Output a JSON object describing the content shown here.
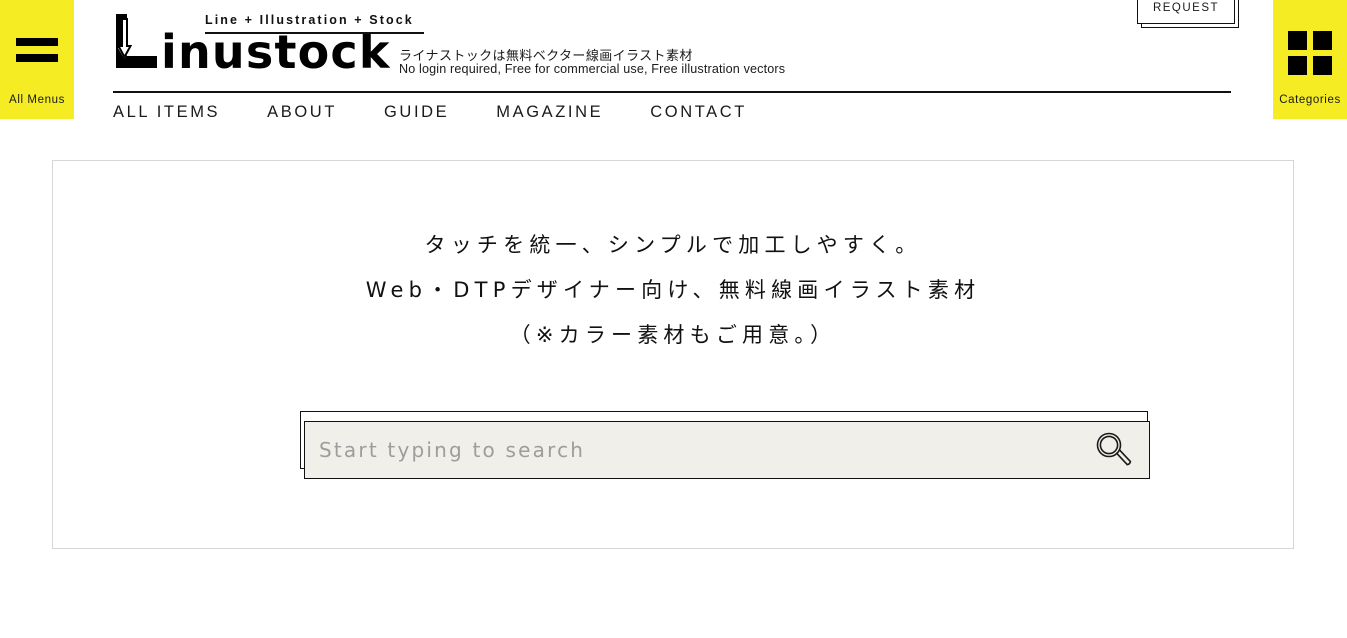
{
  "site": {
    "logo_tagline": "Line + Illustration + Stock",
    "logo_word": "inustock",
    "logo_mark_icon": "l-arrow-logo-icon",
    "tagline_jp": "ライナストックは無料ベクター線画イラスト素材",
    "tagline_en": "No login required, Free for commercial use, Free illustration vectors"
  },
  "colors": {
    "accent_yellow": "#f5ec24",
    "ink": "#111111",
    "search_field_bg": "#f0efe9",
    "content_border": "#d6d6d6",
    "placeholder_text": "#9d9d9d"
  },
  "header": {
    "request_label": "REQUEST",
    "left_tab": {
      "label": "All Menus",
      "icon": "hamburger-icon"
    },
    "right_tab": {
      "label": "Categories",
      "icon": "grid-2x2-icon"
    }
  },
  "nav": {
    "items": [
      {
        "label": "ALL ITEMS"
      },
      {
        "label": "ABOUT"
      },
      {
        "label": "GUIDE"
      },
      {
        "label": "MAGAZINE"
      },
      {
        "label": "CONTACT"
      }
    ]
  },
  "hero": {
    "lines": [
      "タッチを統一、シンプルで加工しやすく。",
      "Web・DTPデザイナー向け、無料線画イラスト素材",
      "（※カラー素材もご用意。）"
    ]
  },
  "search": {
    "value": "",
    "placeholder": "Start typing to search",
    "icon": "magnifier-icon"
  }
}
